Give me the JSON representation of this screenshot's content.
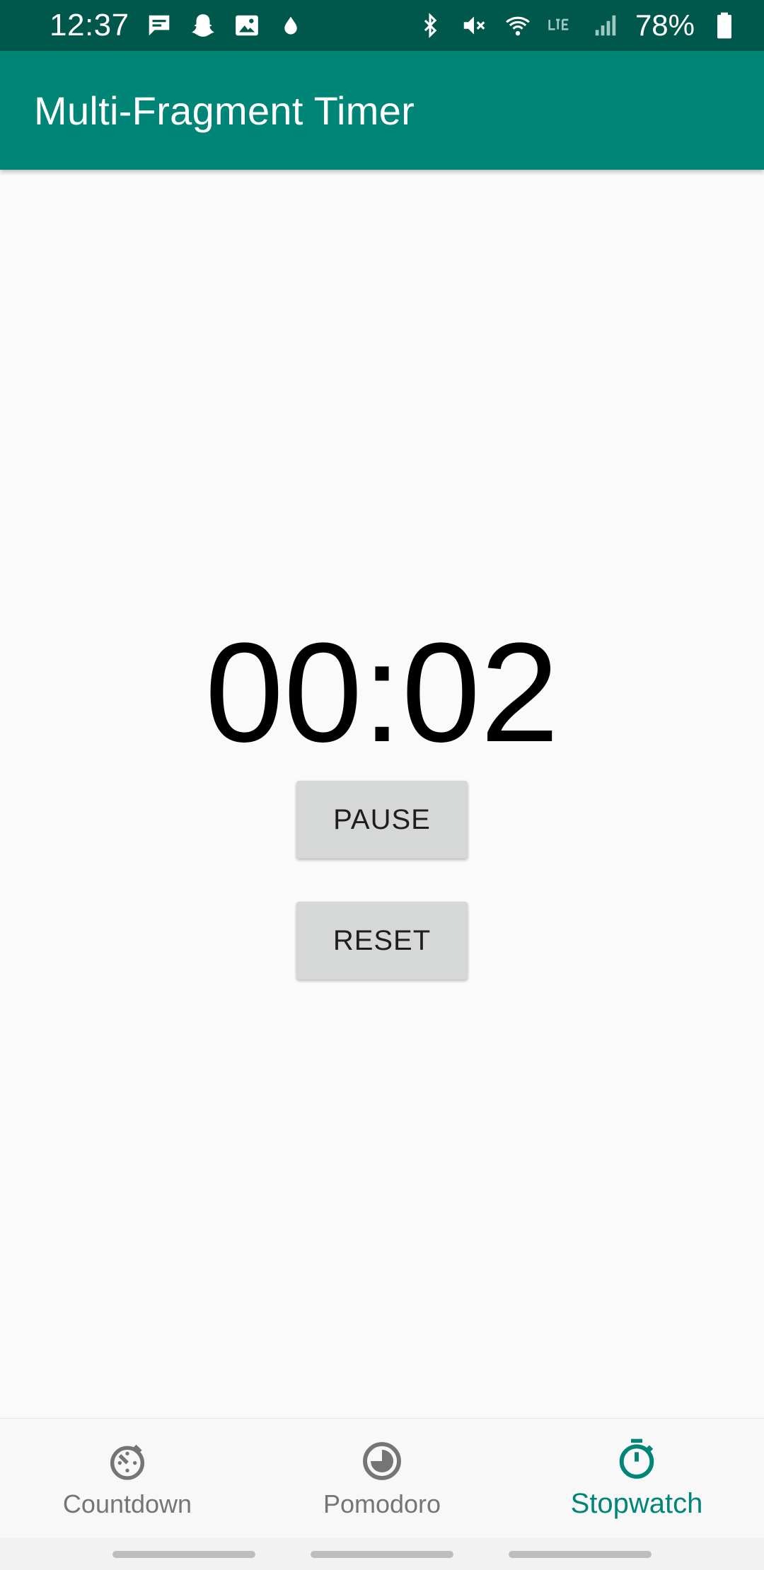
{
  "status_bar": {
    "time": "12:37",
    "battery_percent": "78%",
    "left_icons": [
      "message-icon",
      "snapchat-icon",
      "image-icon",
      "drop-icon"
    ],
    "right_icons": [
      "bluetooth-icon",
      "mute-icon",
      "wifi-icon",
      "lte-icon",
      "signal-icon",
      "battery-icon"
    ]
  },
  "app_bar": {
    "title": "Multi-Fragment Timer"
  },
  "timer": {
    "display": "00:02"
  },
  "buttons": {
    "pause": "PAUSE",
    "reset": "RESET"
  },
  "bottom_nav": {
    "items": [
      {
        "label": "Countdown",
        "icon": "countdown-icon",
        "active": false
      },
      {
        "label": "Pomodoro",
        "icon": "pomodoro-icon",
        "active": false
      },
      {
        "label": "Stopwatch",
        "icon": "stopwatch-icon",
        "active": true
      }
    ]
  },
  "colors": {
    "status_bar": "#00574b",
    "primary": "#008577",
    "background": "#fafafa",
    "button": "#d6d7d7",
    "inactive": "#757575"
  }
}
